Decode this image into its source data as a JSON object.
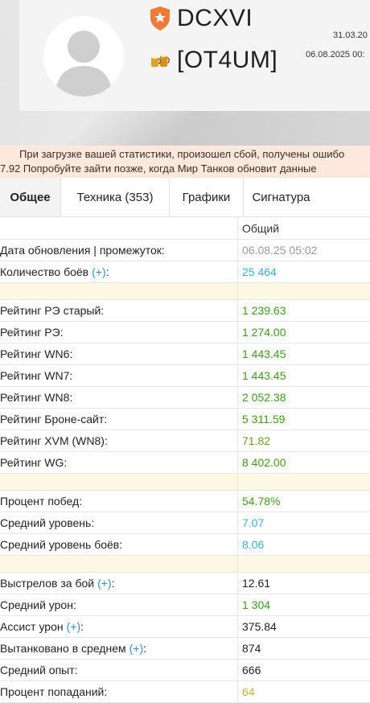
{
  "header": {
    "player_name": "DCXVI",
    "clan_tag": "[OT4UM]",
    "registered_date": "31.03.20",
    "updated_datetime": "06.08.2025 00:",
    "rank_badge_color": "#f07a3a"
  },
  "error_banner": {
    "line1": "При загрузке вашей статистики, произошел сбой, получены ошибо",
    "line2": "7.92 Попробуйте зайти позже, когда Мир Танков обновит данные"
  },
  "tabs": [
    {
      "label": "Общее",
      "active": true
    },
    {
      "label": "Техника (353)",
      "active": false
    },
    {
      "label": "Графики",
      "active": false
    },
    {
      "label": "Сигнатура",
      "active": false
    }
  ],
  "stats": {
    "column_header": "Общий",
    "updated": {
      "label": "Дата обновления | промежуток:",
      "value": "06.08.25 05:02"
    },
    "battles": {
      "label": "Количество боёв",
      "plus": "(+)",
      "colon": ":",
      "value": "25 464"
    },
    "ratings": [
      {
        "label": "Рейтинг РЭ старый:",
        "value": "1 239.63"
      },
      {
        "label": "Рейтинг РЭ:",
        "value": "1 274.00"
      },
      {
        "label": "Рейтинг WN6:",
        "value": "1 443.45"
      },
      {
        "label": "Рейтинг WN7:",
        "value": "1 443.45"
      },
      {
        "label": "Рейтинг WN8:",
        "value": "2 052.38"
      },
      {
        "label": "Рейтинг Броне-сайт:",
        "value": "5 311.59"
      },
      {
        "label": "Рейтинг XVM (WN8):",
        "value": "71.82"
      },
      {
        "label": "Рейтинг WG:",
        "value": "8 402.00"
      }
    ],
    "general": [
      {
        "label": "Процент побед:",
        "value": "54.78%"
      },
      {
        "label": "Средний уровень:",
        "value": "7.07"
      },
      {
        "label": "Средний уровень боёв:",
        "value": "8.06"
      }
    ],
    "combat": [
      {
        "label": "Выстрелов за бой",
        "plus": "(+)",
        "colon": ":",
        "value": "12.61"
      },
      {
        "label": "Средний урон:",
        "value": "1 304"
      },
      {
        "label": "Ассист урон",
        "plus": "(+)",
        "colon": ":",
        "value": "375.84"
      },
      {
        "label": "Вытанковано в среднем",
        "plus": "(+)",
        "colon": ":",
        "value": "874"
      },
      {
        "label": "Средний опыт:",
        "value": "666"
      },
      {
        "label": "Процент попаданий:",
        "value": "64"
      }
    ]
  }
}
